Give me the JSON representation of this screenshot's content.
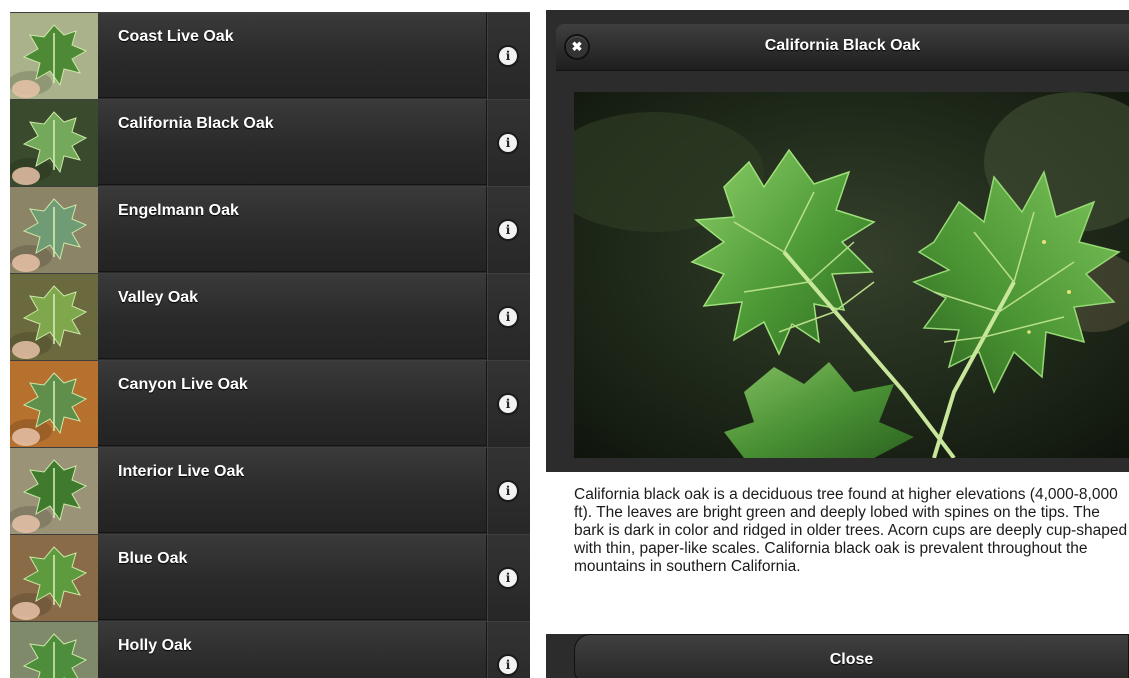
{
  "list": {
    "items": [
      {
        "name": "Coast Live Oak",
        "info_icon": "info-icon",
        "thumb_bg": "#a9b28a",
        "leaf": "#4e8a35"
      },
      {
        "name": "California Black Oak",
        "info_icon": "info-icon",
        "thumb_bg": "#3a4a2c",
        "leaf": "#74a85a"
      },
      {
        "name": "Engelmann Oak",
        "info_icon": "info-icon",
        "thumb_bg": "#8c8466",
        "leaf": "#6f9c74"
      },
      {
        "name": "Valley Oak",
        "info_icon": "info-icon",
        "thumb_bg": "#6b6a3e",
        "leaf": "#7fa84c"
      },
      {
        "name": "Canyon Live Oak",
        "info_icon": "info-icon",
        "thumb_bg": "#b7712f",
        "leaf": "#5f8f4a"
      },
      {
        "name": "Interior Live Oak",
        "info_icon": "info-icon",
        "thumb_bg": "#9a9378",
        "leaf": "#3f7a2f"
      },
      {
        "name": "Blue Oak",
        "info_icon": "info-icon",
        "thumb_bg": "#8a6b48",
        "leaf": "#5e9a3e"
      },
      {
        "name": "Holly Oak",
        "info_icon": "info-icon",
        "thumb_bg": "#7f8a6a",
        "leaf": "#4d8d3c"
      }
    ]
  },
  "detail": {
    "title": "California Black Oak",
    "close_icon": "close-icon",
    "description": "California black oak is a deciduous tree found at higher elevations (4,000-8,000 ft). The leaves are bright green and deeply lobed with spines on the tips. The bark is dark in color and ridged in older trees. Acorn cups are deeply cup-shaped with thin, paper-like scales. California black oak is prevalent throughout the mountains in southern California.",
    "close_label": "Close"
  },
  "colors": {
    "bar_dark": "#2b2b2b",
    "text_light": "#ffffff",
    "photo_leaf": "#4f9a3a"
  }
}
